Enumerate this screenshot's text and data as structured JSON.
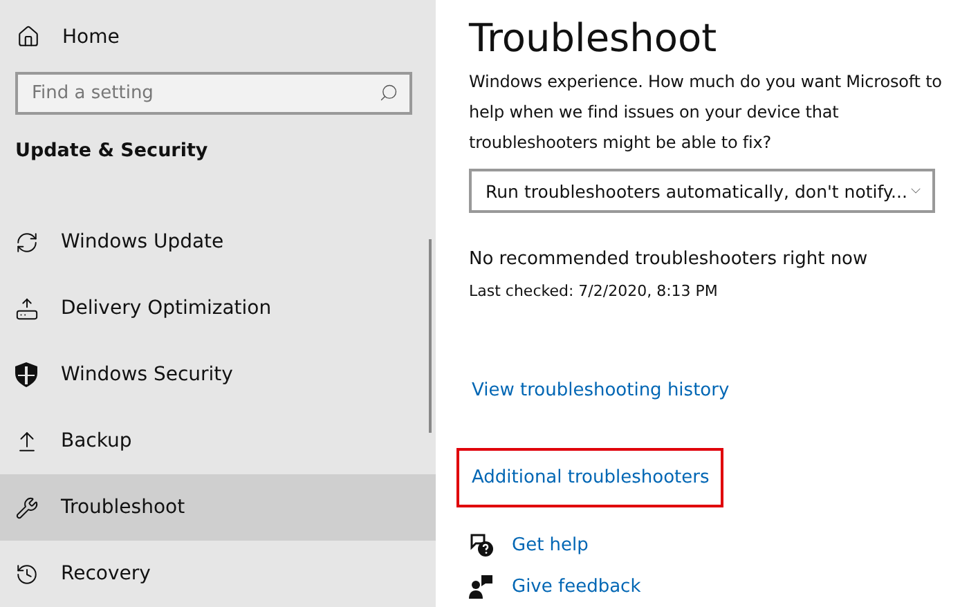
{
  "sidebar": {
    "home": {
      "label": "Home"
    },
    "search": {
      "placeholder": "Find a setting"
    },
    "section_title": "Update & Security",
    "items": [
      {
        "label": "Windows Update",
        "selected": false
      },
      {
        "label": "Delivery Optimization",
        "selected": false
      },
      {
        "label": "Windows Security",
        "selected": false
      },
      {
        "label": "Backup",
        "selected": false
      },
      {
        "label": "Troubleshoot",
        "selected": true
      },
      {
        "label": "Recovery",
        "selected": false
      }
    ]
  },
  "main": {
    "title": "Troubleshoot",
    "description": "Windows experience. How much do you want Microsoft to help when we find issues on your device that troubleshooters might be able to fix?",
    "dropdown": {
      "value": "Run troubleshooters automatically, don't notify..."
    },
    "status": "No recommended troubleshooters right now",
    "last_checked": "Last checked: 7/2/2020, 8:13 PM",
    "links": [
      {
        "label": "View troubleshooting history",
        "highlighted": false
      },
      {
        "label": "Additional troubleshooters",
        "highlighted": true
      }
    ],
    "help_links": [
      {
        "kind": "help",
        "label": "Get help"
      },
      {
        "kind": "feedback",
        "label": "Give feedback"
      }
    ]
  }
}
